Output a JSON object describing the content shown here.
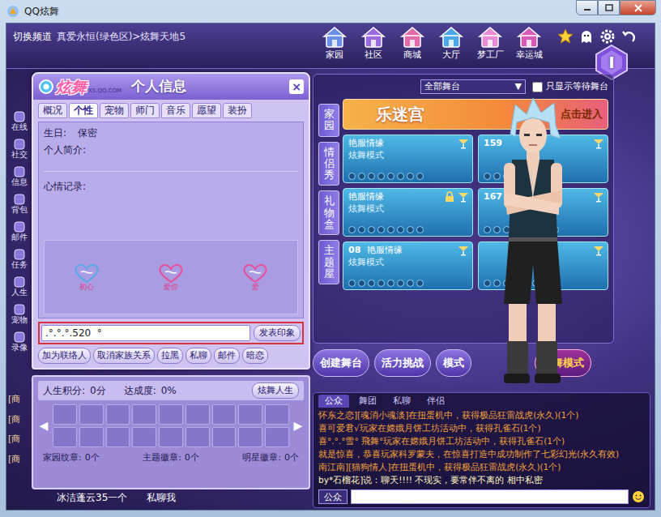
{
  "window": {
    "title": "QQ炫舞"
  },
  "header": {
    "switch": "切换频道",
    "location": "真爱永恒(绿色区)>炫舞天地5"
  },
  "top_nav": [
    {
      "label": "家园"
    },
    {
      "label": "社区"
    },
    {
      "label": "商城"
    },
    {
      "label": "大厅"
    },
    {
      "label": "梦工厂"
    },
    {
      "label": "幸运城"
    }
  ],
  "level_badge": "I",
  "sidebar": [
    {
      "label": "在线"
    },
    {
      "label": "社交"
    },
    {
      "label": "信息"
    },
    {
      "label": "背包"
    },
    {
      "label": "邮件"
    },
    {
      "label": "任务"
    },
    {
      "label": "人生"
    },
    {
      "label": "宠物"
    },
    {
      "label": "录像"
    }
  ],
  "dialog": {
    "logo": "炫舞",
    "logo_site": "X5.QQ.COM",
    "title": "个人信息",
    "close": "×",
    "tabs": [
      {
        "label": "概况",
        "selected": false
      },
      {
        "label": "个性",
        "selected": true
      },
      {
        "label": "宠物",
        "selected": false
      },
      {
        "label": "师门",
        "selected": false
      },
      {
        "label": "音乐",
        "selected": false
      },
      {
        "label": "愿望",
        "selected": false
      },
      {
        "label": "装扮",
        "selected": false
      }
    ],
    "birthday_label": "生日:",
    "birthday": "保密",
    "intro_label": "个人简介:",
    "mood_label": "心情记录:",
    "stickers": [
      "初心",
      "爱你",
      "爱"
    ],
    "impression": ".°.°.°.520  °  ",
    "submit": "发表印象",
    "actions": [
      "加为联络人",
      "取消家族关系",
      "拉黑",
      "私聊",
      "邮件",
      "暗恋"
    ]
  },
  "life": {
    "score_label": "人生积分:",
    "score": "0分",
    "progress_label": "达成度:",
    "progress": "0%",
    "button": "炫舞人生",
    "prev": "◀",
    "next": "▶",
    "badges": [
      {
        "label": "家园纹章:",
        "count": "0个"
      },
      {
        "label": "主题徽章:",
        "count": "0个"
      },
      {
        "label": "明星徽章:",
        "count": "0个"
      }
    ]
  },
  "stage": {
    "filter": "全部舞台",
    "filter_arrow": "▼",
    "only_waiting": {
      "label": "只显示等待舞台",
      "checked": false
    },
    "banner": {
      "title": "乐迷宫",
      "action": "点击进入"
    },
    "side_tabs": [
      "家园",
      "情侣秀",
      "礼物盒",
      "主题屋"
    ],
    "rooms": [
      {
        "title": "艳服情缘",
        "mode": "炫舞模式",
        "locked": false
      },
      {
        "number": "159",
        "locked": false
      },
      {
        "title": "艳服情缘",
        "mode": "炫舞模式",
        "locked": true
      },
      {
        "number": "167",
        "locked": false
      },
      {
        "number": "08",
        "title": "艳服情缘",
        "mode": "炫舞模式",
        "locked": false
      },
      {
        "locked": false
      }
    ],
    "actions": [
      {
        "label": "创建舞台",
        "kind": "normal"
      },
      {
        "label": "活力挑战",
        "kind": "normal"
      },
      {
        "label": "模式",
        "kind": "normal"
      },
      {
        "label": "炫舞模式",
        "kind": "featured"
      }
    ]
  },
  "chat": {
    "tabs": [
      {
        "label": "公众",
        "selected": true
      },
      {
        "label": "舞团",
        "selected": false
      },
      {
        "label": "私聊",
        "selected": false
      },
      {
        "label": "伴侣",
        "selected": false
      }
    ],
    "messages": [
      {
        "text": "怀东之恋][魂消小魂淡]在扭蛋机中，获得极品狂雷战虎(永久)(1个)",
        "color": "#f2a23a"
      },
      {
        "text": "喜可爱君√玩家在嫦娥月饼工坊活动中，获得孔雀石(1个)",
        "color": "#f2a23a"
      },
      {
        "text": "喜°.°.°雪° 飛舞°玩家在嫦娥月饼工坊活动中，获得孔雀石(1个)",
        "color": "#f2a23a"
      },
      {
        "text": "就是惊喜，恭喜玩家科罗蒙夫，在惊喜打造中成功制作了七彩幻光(永久有效)",
        "color": "#f2a23a"
      },
      {
        "text": "南江南][猫狗情人]在扭蛋机中，获得极品狂雷战虎(永久)(1个)",
        "color": "#f2a23a"
      },
      {
        "text": "by*石榴花]说：聊天!!!!  不现实，要常伴不离的  相中私密",
        "color": "#fff4c0"
      }
    ],
    "input_channel": "公众"
  },
  "left_chat": {
    "fragments": [
      "[商",
      "[商",
      "[商",
      "[商"
    ],
    "bottom": "冰洁蓬云35一个",
    "whisper": "私聊我"
  }
}
